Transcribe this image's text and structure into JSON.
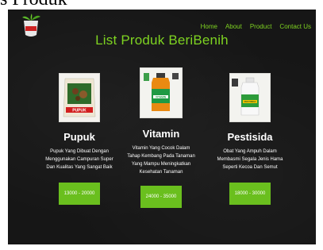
{
  "caption": "s Produk",
  "header": {
    "nav": [
      "Home",
      "About",
      "Product",
      "Contact Us"
    ]
  },
  "title": "List Produk BeriBenih",
  "products": [
    {
      "name": "Pupuk",
      "description": "Pupuk Yang Dibuat Dengan Menggunakan Campuran Super Dan Kualitas Yang Sangat Baik",
      "price": "13000 - 20000",
      "package_label": "PUPUK"
    },
    {
      "name": "Vitamin",
      "description": "Vitamin Yang Cocok Dalam Tahap Kembang Pada Tanaman Yang Mampu Meningkatkan Kesehatan Tanaman",
      "price": "24000 - 35000",
      "package_label": "VITAMIN"
    },
    {
      "name": "Pestisida",
      "description": "Obat Yang Ampuh Dalam Membasmi Segala Jenis Hama Seperti Kecoa Dan Semut",
      "price": "18000 - 30000",
      "package_label": "PESTISIDA"
    }
  ],
  "colors": {
    "accent": "#7ed321",
    "button": "#6abf1e",
    "background": "#161616"
  }
}
